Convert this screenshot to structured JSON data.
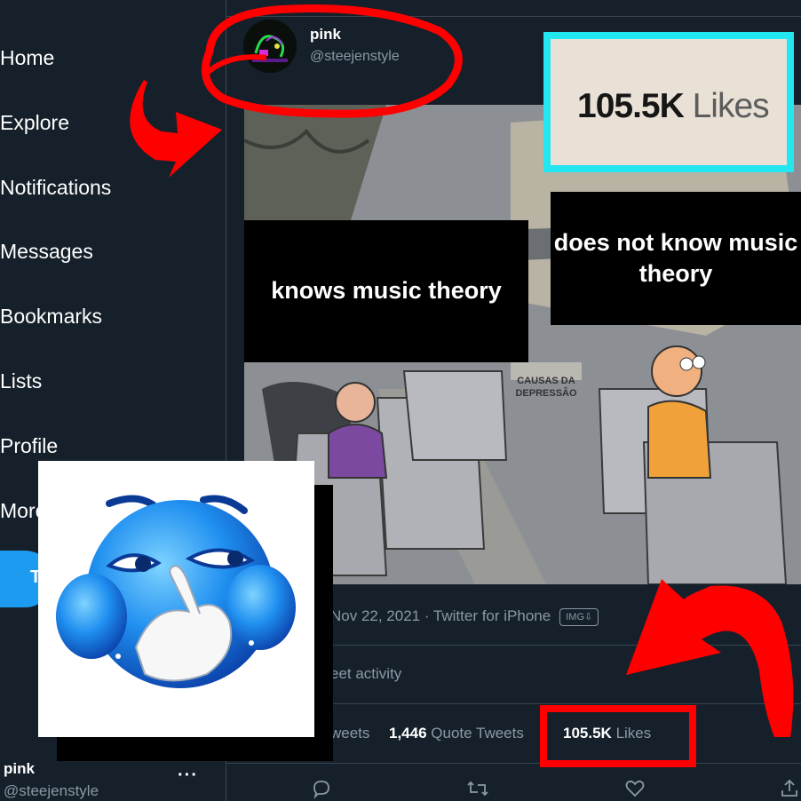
{
  "sidebar": {
    "items": [
      {
        "label": "Home"
      },
      {
        "label": "Explore"
      },
      {
        "label": "Notifications"
      },
      {
        "label": "Messages"
      },
      {
        "label": "Bookmarks"
      },
      {
        "label": "Lists"
      },
      {
        "label": "Profile"
      },
      {
        "label": "More"
      }
    ],
    "tweet_button_label": "T",
    "account": {
      "name": "pink",
      "handle": "@steejenstyle",
      "more": "···"
    }
  },
  "tweet": {
    "author": {
      "name": "pink",
      "handle": "@steejenstyle"
    },
    "meme": {
      "left_caption": "knows music theory",
      "right_caption": "does not know music theory",
      "sign_text": "CAUSAS DA DEPRESSÃO"
    },
    "meta": {
      "date_source": "Nov 22, 2021 · Twitter for iPhone",
      "badge": "IMG⇩"
    },
    "activity": "eet activity",
    "stats": {
      "retweets_label": "weets",
      "quote_count": "1,446",
      "quote_label": "Quote Tweets",
      "likes_count": "105.5K",
      "likes_label": "Likes"
    }
  },
  "callout": {
    "count": "105.5K",
    "label": "Likes"
  },
  "colors": {
    "background": "#15202b",
    "divider": "#38444d",
    "muted_text": "#8b98a5",
    "accent_blue": "#1d9bf0",
    "annotation_red": "#ff0000",
    "callout_border": "#22e6f0",
    "callout_bg": "#e9e1d6"
  },
  "icons": [
    "reply-icon",
    "retweet-icon",
    "like-icon",
    "share-icon",
    "laughing-emoji"
  ]
}
